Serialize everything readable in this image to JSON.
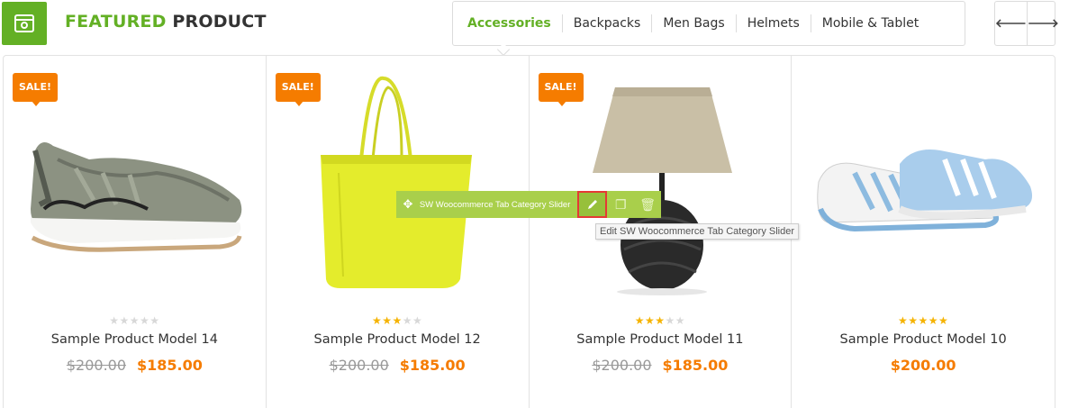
{
  "header": {
    "title_part1": "FEATURED",
    "title_part2": "PRODUCT",
    "icon": "browser-window-icon"
  },
  "tabs": [
    {
      "label": "Accessories",
      "active": true
    },
    {
      "label": "Backpacks",
      "active": false
    },
    {
      "label": "Men Bags",
      "active": false
    },
    {
      "label": "Helmets",
      "active": false
    },
    {
      "label": "Mobile & Tablet",
      "active": false
    }
  ],
  "nav": {
    "prev": "🡐",
    "next": "🡒"
  },
  "products": [
    {
      "name": "Sample Product Model 14",
      "old_price": "$200.00",
      "price": "$185.00",
      "sale": "SALE!",
      "rating": 0
    },
    {
      "name": "Sample Product Model 12",
      "old_price": "$200.00",
      "price": "$185.00",
      "sale": "SALE!",
      "rating": 3
    },
    {
      "name": "Sample Product Model 11",
      "old_price": "$200.00",
      "price": "$185.00",
      "sale": "SALE!",
      "rating": 3
    },
    {
      "name": "Sample Product Model 10",
      "old_price": "",
      "price": "$200.00",
      "sale": "",
      "rating": 5
    }
  ],
  "editor": {
    "label": "SW Woocommerce Tab Category Slider",
    "tooltip": "Edit SW Woocommerce Tab Category Slider"
  },
  "colors": {
    "accent": "#63b025",
    "sale": "#f57c00",
    "star": "#f5b301",
    "toolbar": "#a9cf4b"
  }
}
